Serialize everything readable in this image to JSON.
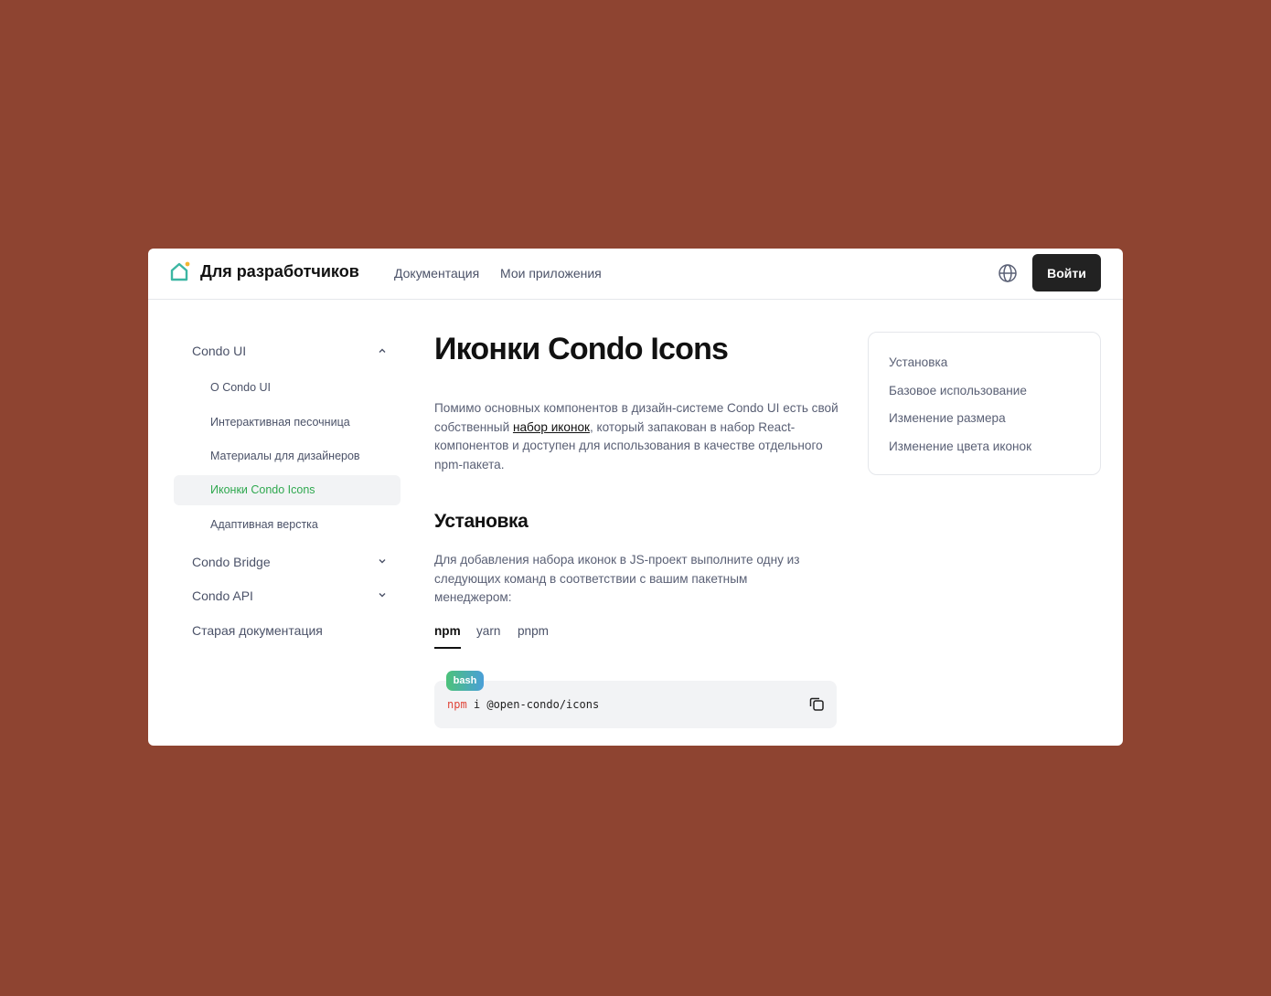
{
  "header": {
    "brand": "Для разработчиков",
    "nav": [
      "Документация",
      "Мои приложения"
    ],
    "login_label": "Войти",
    "logo_icon": "house-icon",
    "language_icon": "globe-icon"
  },
  "sidebar": {
    "sections": [
      {
        "label": "Condo UI",
        "expanded": true,
        "items": [
          {
            "label": "О Condo UI"
          },
          {
            "label": "Интерактивная песочница"
          },
          {
            "label": "Материалы для дизайнеров"
          },
          {
            "label": "Иконки Condo Icons",
            "active": true
          },
          {
            "label": "Адаптивная верстка"
          }
        ]
      },
      {
        "label": "Condo Bridge",
        "expanded": false
      },
      {
        "label": "Condo API",
        "expanded": false
      },
      {
        "label": "Старая документация"
      }
    ]
  },
  "main": {
    "title": "Иконки Condo Icons",
    "intro_before": "Помимо основных компонентов в дизайн-системе Condo UI есть свой собственный ",
    "intro_link": "набор иконок",
    "intro_after": ", который запакован в набор React-компонентов и доступен для использования в качестве отдельного npm-пакета.",
    "install_heading": "Установка",
    "install_text": "Для добавления набора иконок в JS-проект выполните одну из следующих команд в соответствии с вашим пакетным менеджером:",
    "tabs": [
      "npm",
      "yarn",
      "pnpm"
    ],
    "active_tab": "npm",
    "code": {
      "badge": "bash",
      "keyword": "npm",
      "rest": " i @open-condo/icons",
      "copy_icon": "copy-icon"
    }
  },
  "toc": {
    "items": [
      "Установка",
      "Базовое использование",
      "Изменение размера",
      "Изменение цвета иконок"
    ]
  },
  "colors": {
    "background": "#8e4431",
    "accent_green": "#2fa84f",
    "button_dark": "#222222",
    "code_keyword": "#e0463a"
  }
}
